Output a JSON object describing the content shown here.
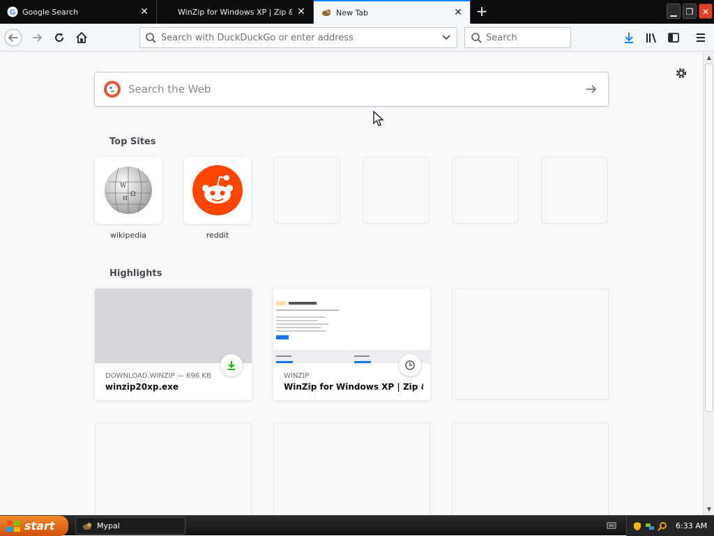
{
  "tabs": [
    {
      "title": "Google Search",
      "favicon": "google-icon",
      "active": false
    },
    {
      "title": "WinZip for Windows XP | Zip & Unzip",
      "favicon": "winzip-icon",
      "active": false
    },
    {
      "title": "New Tab",
      "favicon": "mypal-icon",
      "active": true
    }
  ],
  "urlbar": {
    "placeholder": "Search with DuckDuckGo or enter address",
    "value": ""
  },
  "searchbar": {
    "placeholder": "Search"
  },
  "websearch": {
    "placeholder": "Search the Web"
  },
  "top_sites": {
    "title": "Top Sites",
    "sites": [
      {
        "label": "wikipedia",
        "icon": "wikipedia-icon"
      },
      {
        "label": "reddit",
        "icon": "reddit-icon"
      }
    ]
  },
  "highlights": {
    "title": "Highlights",
    "cards": [
      {
        "meta": "DOWNLOAD.WINZIP — 696 KB",
        "title": "winzip20xp.exe",
        "badge": "download-icon"
      },
      {
        "meta": "WINZIP",
        "title": "WinZip for Windows XP | Zip & ...",
        "badge": "history-icon"
      }
    ]
  },
  "taskbar": {
    "start_label": "start",
    "tasks": [
      {
        "label": "Mypal"
      }
    ],
    "clock": "6:33 AM"
  },
  "colors": {
    "accent": "#0a84ff",
    "reddit": "#ff4500",
    "download_green": "#12bc00"
  }
}
